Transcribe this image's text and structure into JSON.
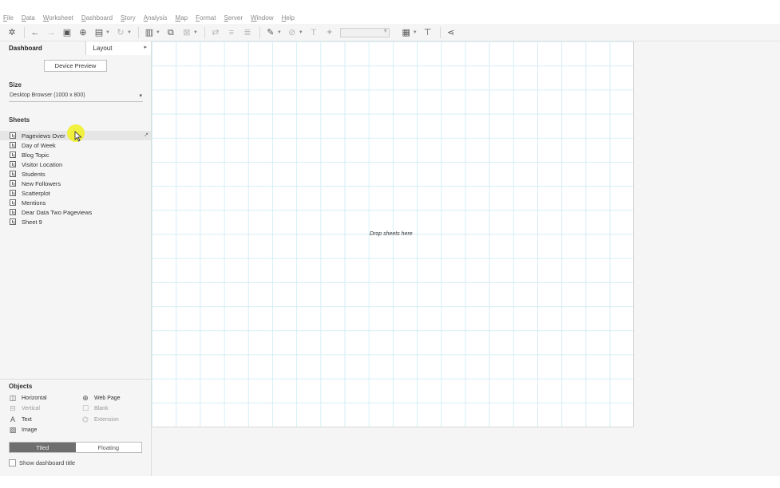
{
  "menu": {
    "items": [
      "File",
      "Data",
      "Worksheet",
      "Dashboard",
      "Story",
      "Analysis",
      "Map",
      "Format",
      "Server",
      "Window",
      "Help"
    ]
  },
  "toolbar": {
    "icons": [
      "tableau-logo-icon",
      "undo-icon",
      "redo-icon",
      "save-icon",
      "new-data-source-icon",
      "pause-updates-icon",
      "refresh-icon",
      "new-sheet-icon",
      "duplicate-icon",
      "clear-icon",
      "swap-icon",
      "sort-ascending-icon",
      "sort-descending-icon",
      "highlight-icon",
      "group-icon",
      "label-icon",
      "pin-icon",
      "fit-select",
      "show-cards-icon",
      "presentation-icon",
      "share-icon"
    ]
  },
  "left_panel": {
    "tabs": {
      "dashboard": "Dashboard",
      "layout": "Layout"
    },
    "device_preview": "Device Preview",
    "size_title": "Size",
    "size_value": "Desktop Browser (1000 x 800)",
    "sheets_title": "Sheets",
    "sheets": [
      "Pageviews Over",
      "Day of Week",
      "Blog Topic",
      "Visitor Location",
      "Students",
      "New Followers",
      "Scatterplot",
      "Mentions",
      "Dear Data Two Pageviews",
      "Sheet 9"
    ],
    "objects_title": "Objects",
    "objects": {
      "horizontal": "Horizontal",
      "vertical": "Vertical",
      "text": "Text",
      "image": "Image",
      "web_page": "Web Page",
      "blank": "Blank",
      "extension": "Extension"
    },
    "tiled": "Tiled",
    "floating": "Floating",
    "show_title": "Show dashboard title"
  },
  "canvas": {
    "drop_text": "Drop sheets here"
  },
  "colors": {
    "grid_line": "#d6eef6",
    "highlight": "#f0f01e",
    "toggle_active": "#6e6e6e"
  }
}
